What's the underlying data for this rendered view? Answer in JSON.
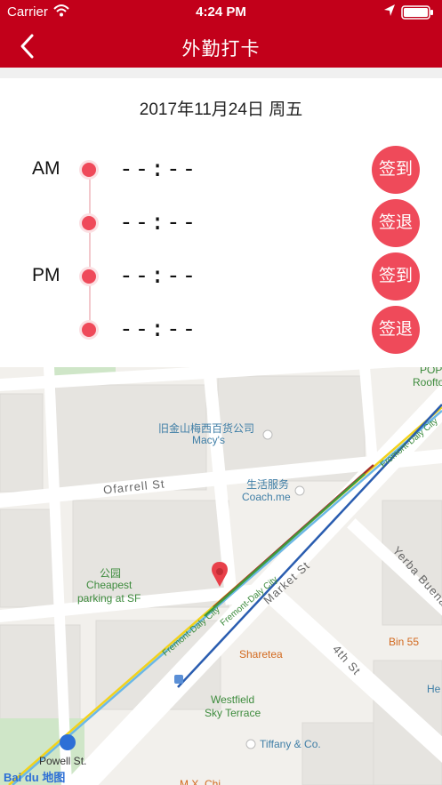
{
  "status_bar": {
    "carrier": "Carrier",
    "time": "4:24 PM"
  },
  "nav": {
    "title": "外勤打卡"
  },
  "date_text": "2017年11月24日 周五",
  "rows": [
    {
      "period": "AM",
      "time": "--:--",
      "button": "签到"
    },
    {
      "period": "",
      "time": "--:--",
      "button": "签退"
    },
    {
      "period": "PM",
      "time": "--:--",
      "button": "签到"
    },
    {
      "period": "",
      "time": "--:--",
      "button": "签退"
    }
  ],
  "map": {
    "streets": {
      "ofarrell": "Ofarrell St",
      "market": "Market St",
      "fremont_daly_1": "Fremont-Daly City",
      "fremont_daly_2": "Fremont-Daly City",
      "fremont_daly_3": "Fremont-Daly City",
      "fourth": "4th St",
      "yerba": "Yerba Buena"
    },
    "pois": {
      "macys_cn": "旧金山梅西百货公司",
      "macys_en": "Macy's",
      "coach_cn": "生活服务",
      "coach_en": "Coach.me",
      "park_cn": "公园",
      "park_en1": "Cheapest",
      "park_en2": "parking at SF",
      "sharetea": "Sharetea",
      "bin55": "Bin 55",
      "westfield1": "Westfield",
      "westfield2": "Sky Terrace",
      "tiffany": "Tiffany & Co.",
      "powell": "Powell St.",
      "pop1": "POP",
      "pop2": "Roofto",
      "he": "He",
      "mx": "M.X. Chi"
    },
    "logo": "Bai du 地图"
  },
  "colors": {
    "primary": "#c2001a",
    "accent": "#ef4a5a"
  }
}
